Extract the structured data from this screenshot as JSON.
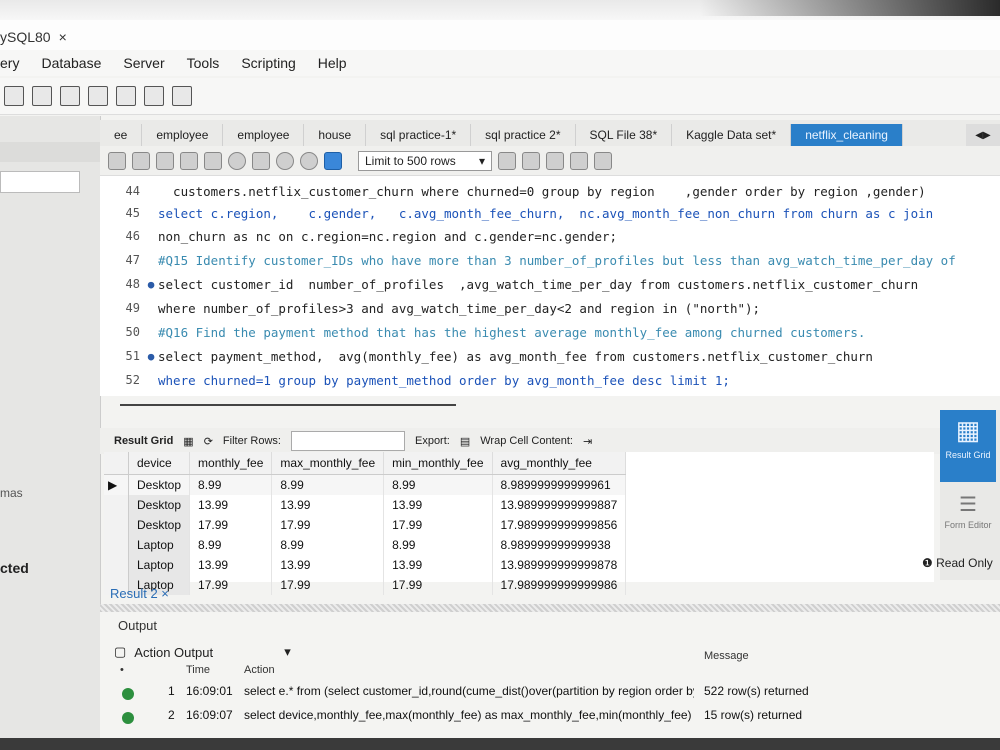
{
  "app": {
    "window_tab_title": "ySQL80",
    "close_glyph": "×"
  },
  "menu": [
    "ery",
    "Database",
    "Server",
    "Tools",
    "Scripting",
    "Help"
  ],
  "left_panel": {
    "schemas_label": "mas",
    "selected_label": "cted"
  },
  "tabs": [
    {
      "label": "ee",
      "active": false
    },
    {
      "label": "employee",
      "active": false
    },
    {
      "label": "employee",
      "active": false
    },
    {
      "label": "house",
      "active": false
    },
    {
      "label": "sql practice-1*",
      "active": false
    },
    {
      "label": "sql practice 2*",
      "active": false
    },
    {
      "label": "SQL File 38*",
      "active": false
    },
    {
      "label": "Kaggle Data set*",
      "active": false
    },
    {
      "label": "netflix_cleaning",
      "active": true
    }
  ],
  "editor_toolbar": {
    "limit_label": "Limit to 500 rows"
  },
  "editor": {
    "lines": [
      {
        "num": "44",
        "dot": "",
        "text": "  customers.netflix_customer_churn where churned=0 group by region    ,gender order by region ,gender)"
      },
      {
        "num": "45",
        "dot": "",
        "text": "select c.region,    c.gender,   c.avg_month_fee_churn,  nc.avg_month_fee_non_churn from churn as c join"
      },
      {
        "num": "46",
        "dot": "",
        "text": "non_churn as nc on c.region=nc.region and c.gender=nc.gender;"
      },
      {
        "num": "47",
        "dot": "",
        "text": "#Q15 Identify customer_IDs who have more than 3 number_of_profiles but less than avg_watch_time_per_day of"
      },
      {
        "num": "48",
        "dot": "●",
        "text": "select customer_id  number_of_profiles  ,avg_watch_time_per_day from customers.netflix_customer_churn"
      },
      {
        "num": "49",
        "dot": "",
        "text": "where number_of_profiles>3 and avg_watch_time_per_day<2 and region in (\"north\");"
      },
      {
        "num": "50",
        "dot": "",
        "text": "#Q16 Find the payment method that has the highest average monthly_fee among churned customers."
      },
      {
        "num": "51",
        "dot": "●",
        "text": "select payment_method,  avg(monthly_fee) as avg_month_fee from customers.netflix_customer_churn"
      },
      {
        "num": "52",
        "dot": "",
        "text": "where churned=1 group by payment_method order by avg_month_fee desc limit 1;"
      }
    ]
  },
  "result_toolbar": {
    "result_grid": "Result Grid",
    "filter_rows": "Filter Rows:",
    "export": "Export:",
    "wrap": "Wrap Cell Content:"
  },
  "grid": {
    "columns": [
      "device",
      "monthly_fee",
      "max_monthly_fee",
      "min_monthly_fee",
      "avg_monthly_fee"
    ],
    "rows": [
      [
        "Desktop",
        "8.99",
        "8.99",
        "8.99",
        "8.989999999999961"
      ],
      [
        "Desktop",
        "13.99",
        "13.99",
        "13.99",
        "13.989999999999887"
      ],
      [
        "Desktop",
        "17.99",
        "17.99",
        "17.99",
        "17.989999999999856"
      ],
      [
        "Laptop",
        "8.99",
        "8.99",
        "8.99",
        "8.989999999999938"
      ],
      [
        "Laptop",
        "13.99",
        "13.99",
        "13.99",
        "13.989999999999878"
      ],
      [
        "Laptop",
        "17.99",
        "17.99",
        "17.99",
        "17.989999999999986"
      ]
    ]
  },
  "side_panel": {
    "result_grid": "Result Grid",
    "form_editor": "Form Editor",
    "read_only": "Read Only"
  },
  "result_tab": "Result 2 ×",
  "output": {
    "title": "Output",
    "mode": "Action Output",
    "headers": {
      "time": "Time",
      "action": "Action",
      "message": "Message"
    },
    "rows": [
      {
        "num": "1",
        "time": "16:09:01",
        "action": "select e.* from (select customer_id,round(cume_dist()over(partition by region order by ...",
        "message": "522 row(s) returned"
      },
      {
        "num": "2",
        "time": "16:09:07",
        "action": "select device,monthly_fee,max(monthly_fee) as max_monthly_fee,min(monthly_fee) as...",
        "message": "15 row(s) returned"
      }
    ]
  }
}
